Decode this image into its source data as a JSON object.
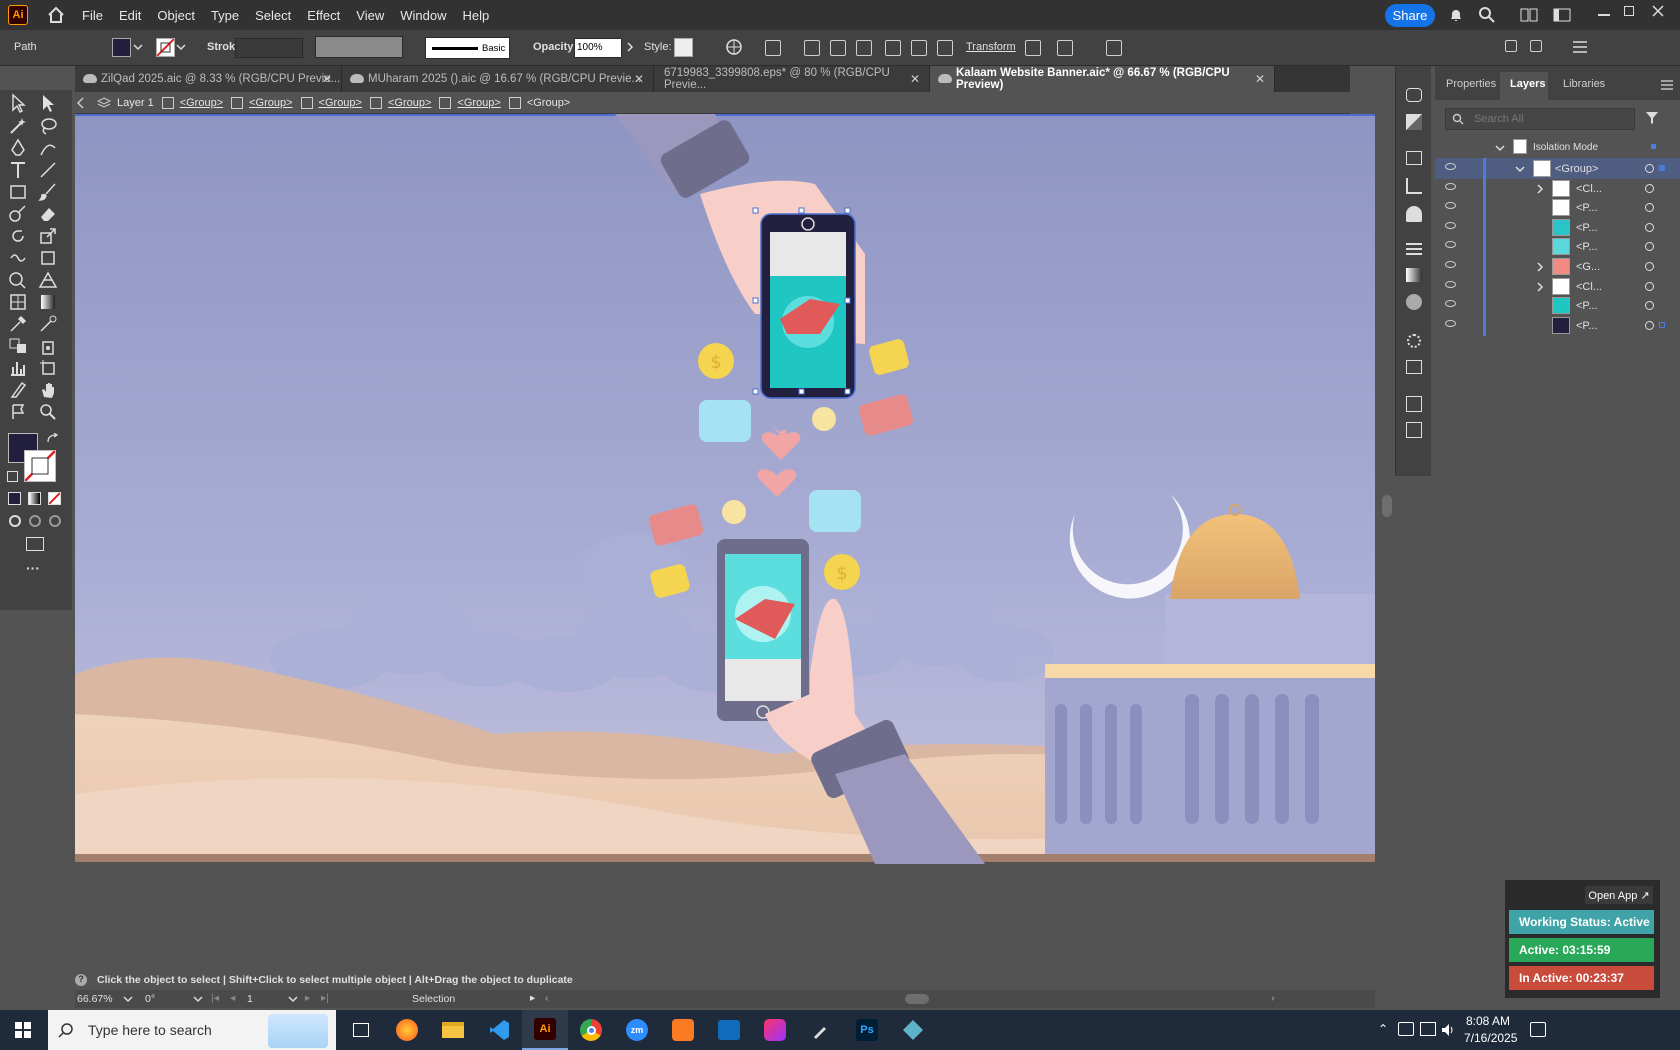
{
  "app": {
    "logo": "Ai",
    "menus": [
      "File",
      "Edit",
      "Object",
      "Type",
      "Select",
      "Effect",
      "View",
      "Window",
      "Help"
    ],
    "share_label": "Share"
  },
  "control": {
    "selection_label": "Path",
    "stroke_label": "Stroke:",
    "brush_label": "Basic",
    "opacity_label": "Opacity:",
    "opacity_value": "100%",
    "style_label": "Style:",
    "transform_label": "Transform",
    "fill_color": "#23203f"
  },
  "tabs": [
    {
      "label": "ZilQad 2025.aic @ 8.33 % (RGB/CPU Previe...",
      "active": false
    },
    {
      "label": "MUharam 2025 ().aic @ 16.67 % (RGB/CPU Previe...",
      "active": false
    },
    {
      "label": "6719983_3399808.eps* @ 80 % (RGB/CPU Previe...",
      "active": false
    },
    {
      "label": "Kalaam Website Banner.aic* @ 66.67 % (RGB/CPU Preview)",
      "active": true
    }
  ],
  "breadcrumb": [
    "Layer 1",
    "<Group>",
    "<Group>",
    "<Group>",
    "<Group>",
    "<Group>",
    "<Group>"
  ],
  "panel": {
    "tabs": [
      "Properties",
      "Layers",
      "Libraries"
    ],
    "search_placeholder": "Search All",
    "isolation_label": "Isolation Mode",
    "rows": [
      {
        "label": "<Group>",
        "expand": true,
        "open": true,
        "thumb": "#ffffff"
      },
      {
        "label": "<Cl...",
        "expand": true,
        "open": false,
        "thumb": "#ffffff"
      },
      {
        "label": "<P...",
        "expand": false,
        "open": false,
        "thumb": "#ffffff"
      },
      {
        "label": "<P...",
        "expand": false,
        "open": false,
        "thumb": "#29c3c8"
      },
      {
        "label": "<P...",
        "expand": false,
        "open": false,
        "thumb": "#5cd8dc"
      },
      {
        "label": "<G...",
        "expand": true,
        "open": false,
        "thumb": "#f28b82"
      },
      {
        "label": "<Cl...",
        "expand": true,
        "open": false,
        "thumb": "#ffffff"
      },
      {
        "label": "<P...",
        "expand": false,
        "open": false,
        "thumb": "#1fc6c2"
      },
      {
        "label": "<P...",
        "expand": false,
        "open": false,
        "thumb": "#23203f"
      }
    ]
  },
  "status": {
    "hint": "Click the object to select  |  Shift+Click to select multiple object  |  Alt+Drag the object to duplicate",
    "zoom": "66.67%",
    "rotation": "0°",
    "artboard_num": "1",
    "tool_name": "Selection"
  },
  "tracker": {
    "open_app": "Open App ↗",
    "working": "Working Status: Active",
    "active": "Active: 03:15:59",
    "inactive": "In Active: 00:23:37",
    "colors": {
      "working": "#3fa3a8",
      "active": "#2aa85a",
      "inactive": "#c84b3c"
    }
  },
  "taskbar": {
    "search_placeholder": "Type here to search",
    "time": "8:08 AM",
    "date": "7/16/2025"
  }
}
